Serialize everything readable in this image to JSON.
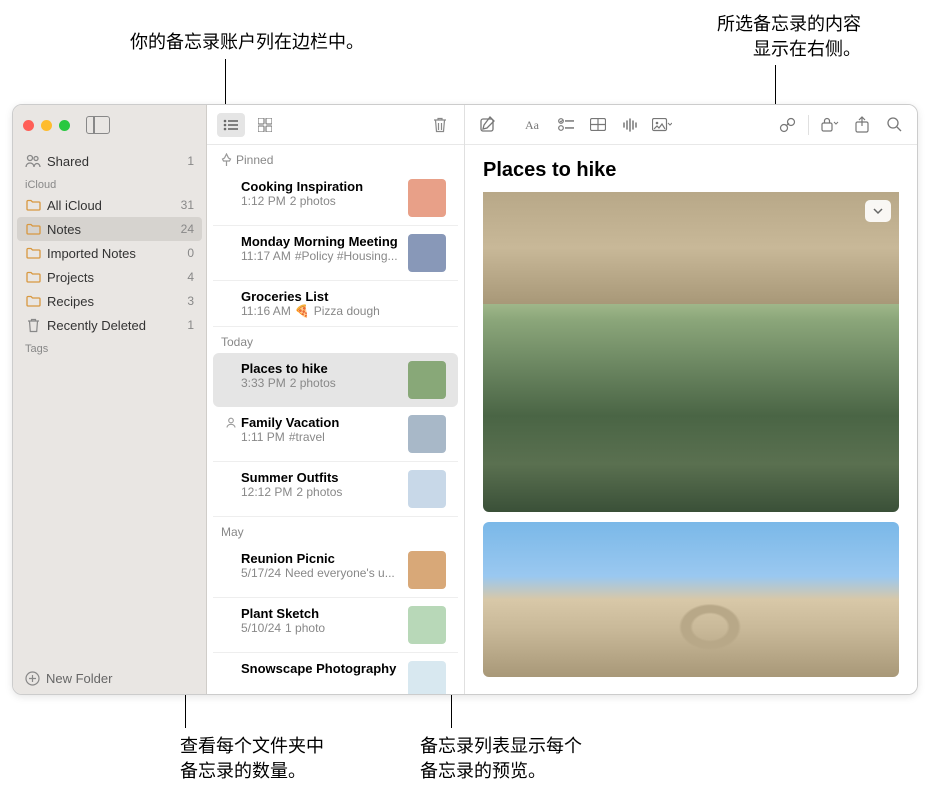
{
  "callouts": {
    "top_left": "你的备忘录账户列在边栏中。",
    "top_right_1": "所选备忘录的内容",
    "top_right_2": "显示在右侧。",
    "bottom_left_1": "查看每个文件夹中",
    "bottom_left_2": "备忘录的数量。",
    "bottom_right_1": "备忘录列表显示每个",
    "bottom_right_2": "备忘录的预览。"
  },
  "sidebar": {
    "shared": {
      "label": "Shared",
      "count": "1"
    },
    "section_icloud": "iCloud",
    "folders": [
      {
        "label": "All iCloud",
        "count": "31"
      },
      {
        "label": "Notes",
        "count": "24",
        "selected": true
      },
      {
        "label": "Imported Notes",
        "count": "0"
      },
      {
        "label": "Projects",
        "count": "4"
      },
      {
        "label": "Recipes",
        "count": "3"
      },
      {
        "label": "Recently Deleted",
        "count": "1",
        "trash": true
      }
    ],
    "section_tags": "Tags",
    "new_folder": "New Folder"
  },
  "notelist": {
    "sections": [
      {
        "label": "Pinned",
        "pinned": true,
        "items": [
          {
            "title": "Cooking Inspiration",
            "time": "1:12 PM",
            "sub": "2 photos",
            "thumb": "#e8a088"
          },
          {
            "title": "Monday Morning Meeting",
            "time": "11:17 AM",
            "sub": "#Policy #Housing...",
            "thumb": "#8898b8"
          },
          {
            "title": "Groceries List",
            "time": "11:16 AM",
            "sub": "Pizza dough",
            "pizza": true
          }
        ]
      },
      {
        "label": "Today",
        "items": [
          {
            "title": "Places to hike",
            "time": "3:33 PM",
            "sub": "2 photos",
            "selected": true,
            "thumb": "#88a878"
          },
          {
            "title": "Family Vacation",
            "time": "1:11 PM",
            "sub": "#travel",
            "shared": true,
            "thumb": "#a8b8c8"
          },
          {
            "title": "Summer Outfits",
            "time": "12:12 PM",
            "sub": "2 photos",
            "thumb": "#c8d8e8"
          }
        ]
      },
      {
        "label": "May",
        "items": [
          {
            "title": "Reunion Picnic",
            "time": "5/17/24",
            "sub": "Need everyone's u...",
            "thumb": "#d8a878"
          },
          {
            "title": "Plant Sketch",
            "time": "5/10/24",
            "sub": "1 photo",
            "thumb": "#b8d8b8"
          },
          {
            "title": "Snowscape Photography",
            "time": "",
            "sub": "",
            "thumb": "#d8e8f0"
          }
        ]
      }
    ]
  },
  "editor": {
    "title": "Places to hike"
  }
}
